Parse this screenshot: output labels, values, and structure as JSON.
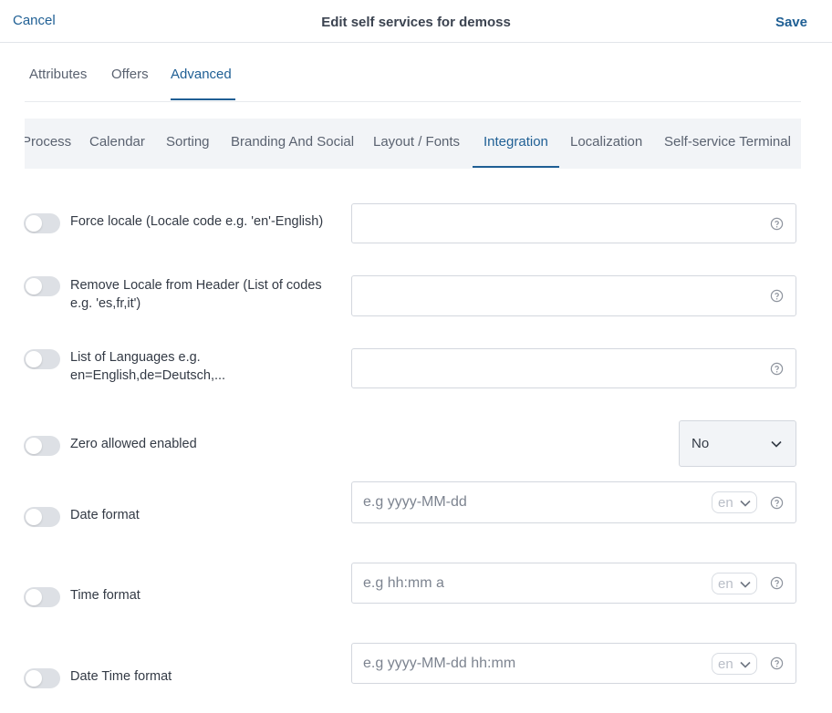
{
  "header": {
    "cancel_label": "Cancel",
    "title": "Edit self services for demoss",
    "save_label": "Save"
  },
  "tabs": [
    "Attributes",
    "Offers",
    "Advanced"
  ],
  "active_tab": "Advanced",
  "subtabs": [
    "Process",
    "Calendar",
    "Sorting",
    "Branding And Social",
    "Layout / Fonts",
    "Integration",
    "Localization",
    "Self-service Terminal"
  ],
  "active_subtab": "Integration",
  "settings": [
    {
      "label": "Force locale (Locale code e.g. 'en'-English)",
      "value": "",
      "placeholder": "",
      "enabled": false
    },
    {
      "label": "Remove Locale from Header (List of codes e.g. 'es,fr,it')",
      "value": "",
      "placeholder": "",
      "enabled": false
    },
    {
      "label": "List of Languages e.g. en=English,de=Deutsch,...",
      "value": "",
      "placeholder": "",
      "enabled": false
    },
    {
      "label": "Zero allowed enabled",
      "select_value": "No",
      "enabled": false
    },
    {
      "label": "Date format",
      "value": "",
      "placeholder": "e.g yyyy-MM-dd",
      "locale": "en",
      "enabled": false
    },
    {
      "label": "Time format",
      "value": "",
      "placeholder": "e.g hh:mm a",
      "locale": "en",
      "enabled": false
    },
    {
      "label": "Date Time format",
      "value": "",
      "placeholder": "e.g yyyy-MM-dd hh:mm",
      "locale": "en",
      "enabled": false
    }
  ],
  "icons": {
    "help": "help-circle-icon",
    "chevron": "chevron-down-icon"
  },
  "colors": {
    "accent": "#1f5f94",
    "toggle_off": "#dde0e5",
    "subtab_bg": "#f2f4f7"
  }
}
